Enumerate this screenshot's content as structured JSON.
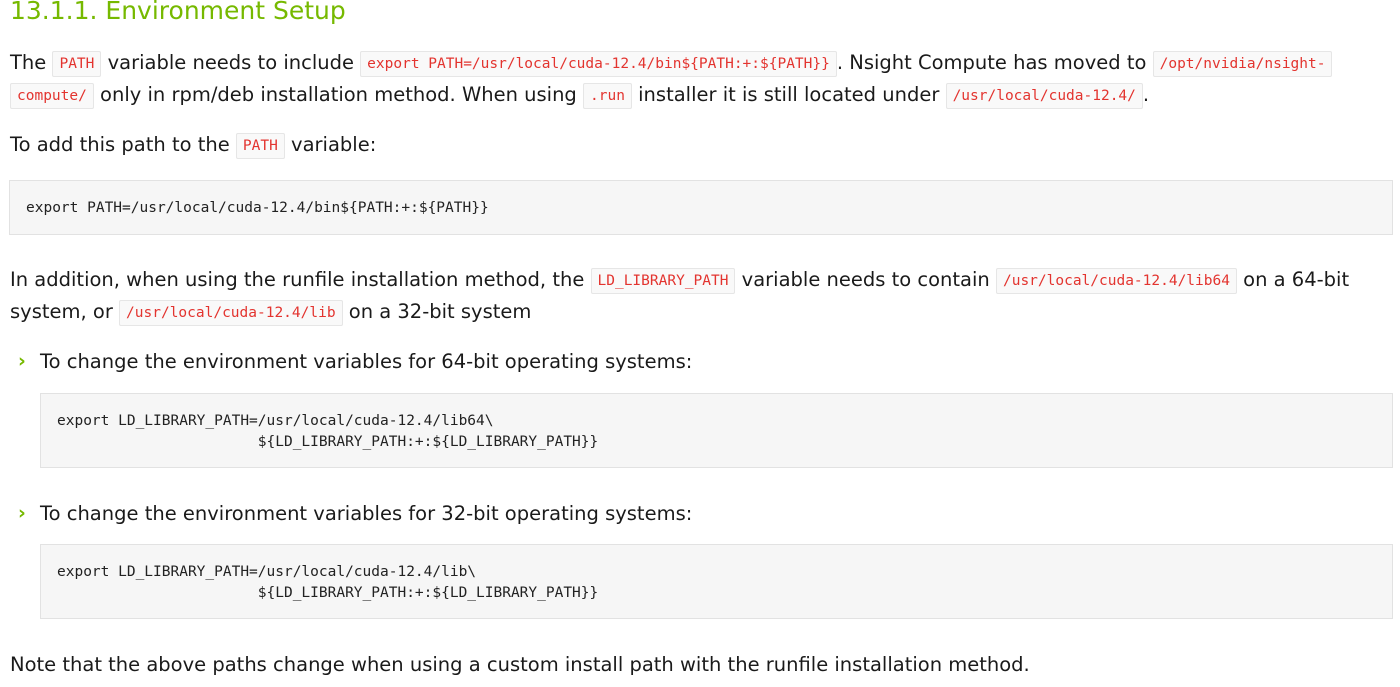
{
  "section": {
    "title": "13.1.1. Environment Setup"
  },
  "para1": {
    "t1": "The ",
    "c1": "PATH",
    "t2": " variable needs to include ",
    "c2": "export PATH=/usr/local/cuda-12.4/bin${PATH:+:${PATH}}",
    "t3": ". Nsight Compute has moved to ",
    "c3a": "/opt/nvidia/nsight-",
    "c3b": "compute/",
    "t4": " only in rpm/deb installation method. When using ",
    "c4": ".run",
    "t5": " installer it is still located under ",
    "c5": "/usr/local/cuda-12.4/",
    "t6": "."
  },
  "para2": {
    "t1": "To add this path to the ",
    "c1": "PATH",
    "t2": " variable:"
  },
  "code1": "export PATH=/usr/local/cuda-12.4/bin${PATH:+:${PATH}}",
  "para3": {
    "t1": "In addition, when using the runfile installation method, the ",
    "c1": "LD_LIBRARY_PATH",
    "t2": " variable needs to contain ",
    "c2": "/usr/local/cuda-12.4/lib64",
    "t3": " on a 64-bit",
    "t4": "system, or ",
    "c3": "/usr/local/cuda-12.4/lib",
    "t5": " on a 32-bit system"
  },
  "list": [
    {
      "bullet": "›",
      "text": "To change the environment variables for 64-bit operating systems:",
      "code": "export LD_LIBRARY_PATH=/usr/local/cuda-12.4/lib64\\\n                       ${LD_LIBRARY_PATH:+:${LD_LIBRARY_PATH}}"
    },
    {
      "bullet": "›",
      "text": "To change the environment variables for 32-bit operating systems:",
      "code": "export LD_LIBRARY_PATH=/usr/local/cuda-12.4/lib\\\n                       ${LD_LIBRARY_PATH:+:${LD_LIBRARY_PATH}}"
    }
  ],
  "note": "Note that the above paths change when using a custom install path with the runfile installation method.",
  "colors": {
    "heading": "#76b900",
    "inline_code": "#e3342f",
    "code_bg": "#f6f6f6"
  }
}
